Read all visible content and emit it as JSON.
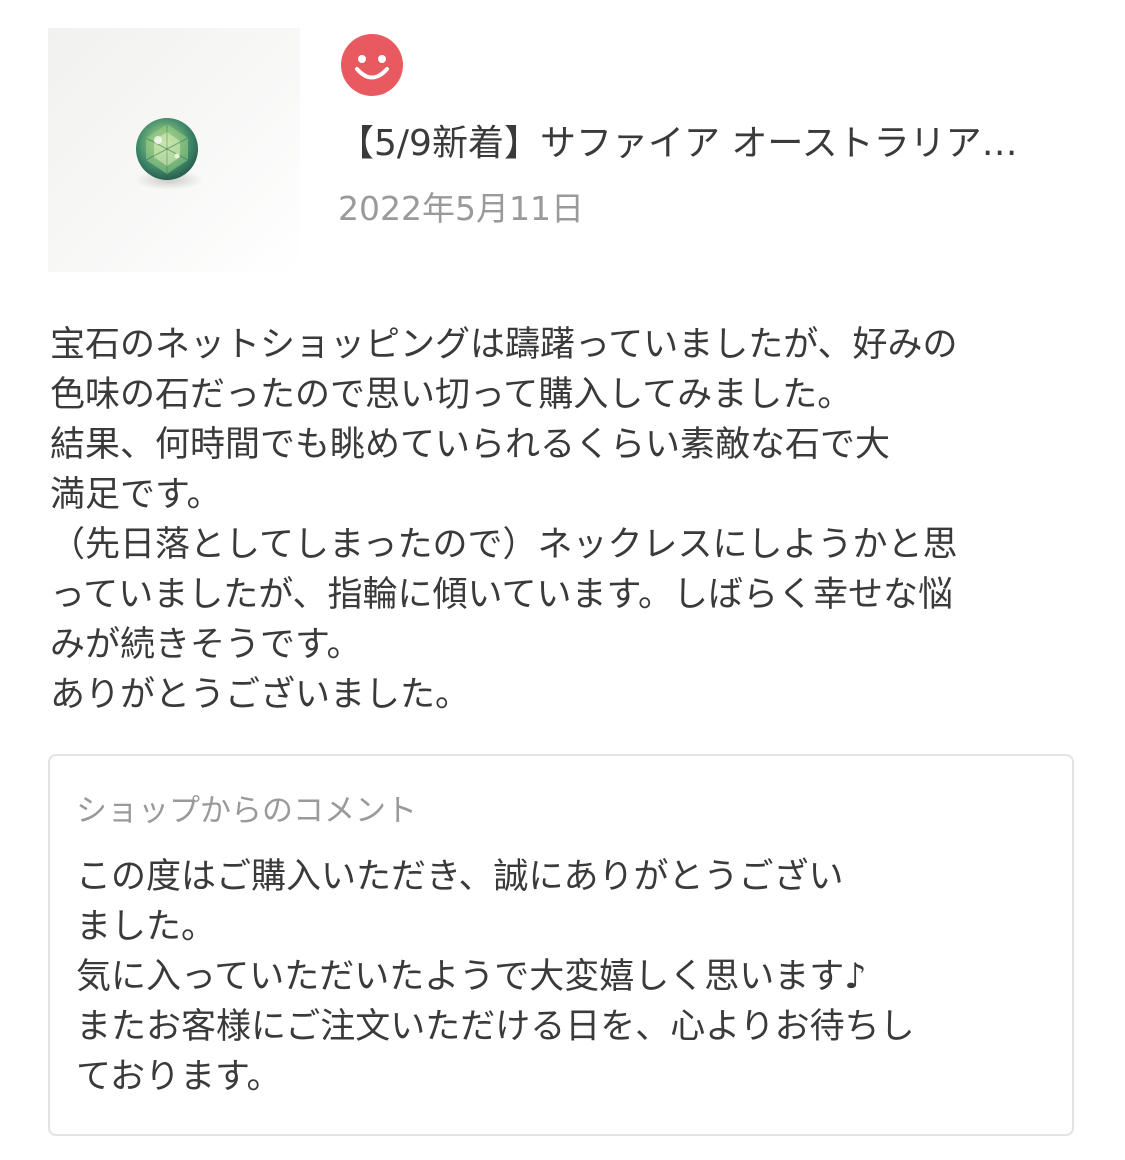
{
  "product": {
    "image_icon": "green-sapphire-gem-photo",
    "title": "【5/9新着】サファイア オーストラリア産…"
  },
  "review": {
    "rating_icon": "smiley-face-icon",
    "rating_color": "#e85a5f",
    "date": "2022年5月11日",
    "body_lines": [
      "宝石のネットショッピングは躊躇っていましたが、好みの",
      "色味の石だったので思い切って購入してみました。",
      "結果、何時間でも眺めていられるくらい素敵な石で大",
      "満足です。",
      "（先日落としてしまったので）ネックレスにしようかと思",
      "っていましたが、指輪に傾いています。しばらく幸せな悩",
      "みが続きそうです。",
      "ありがとうございました。"
    ]
  },
  "shop_comment": {
    "title": "ショップからのコメント",
    "body_lines": [
      "この度はご購入いただき、誠にありがとうござい",
      "ました。",
      "気に入っていただいたようで大変嬉しく思います♪",
      "またお客様にご注文いただける日を、心よりお待ちし",
      "ております。"
    ]
  }
}
